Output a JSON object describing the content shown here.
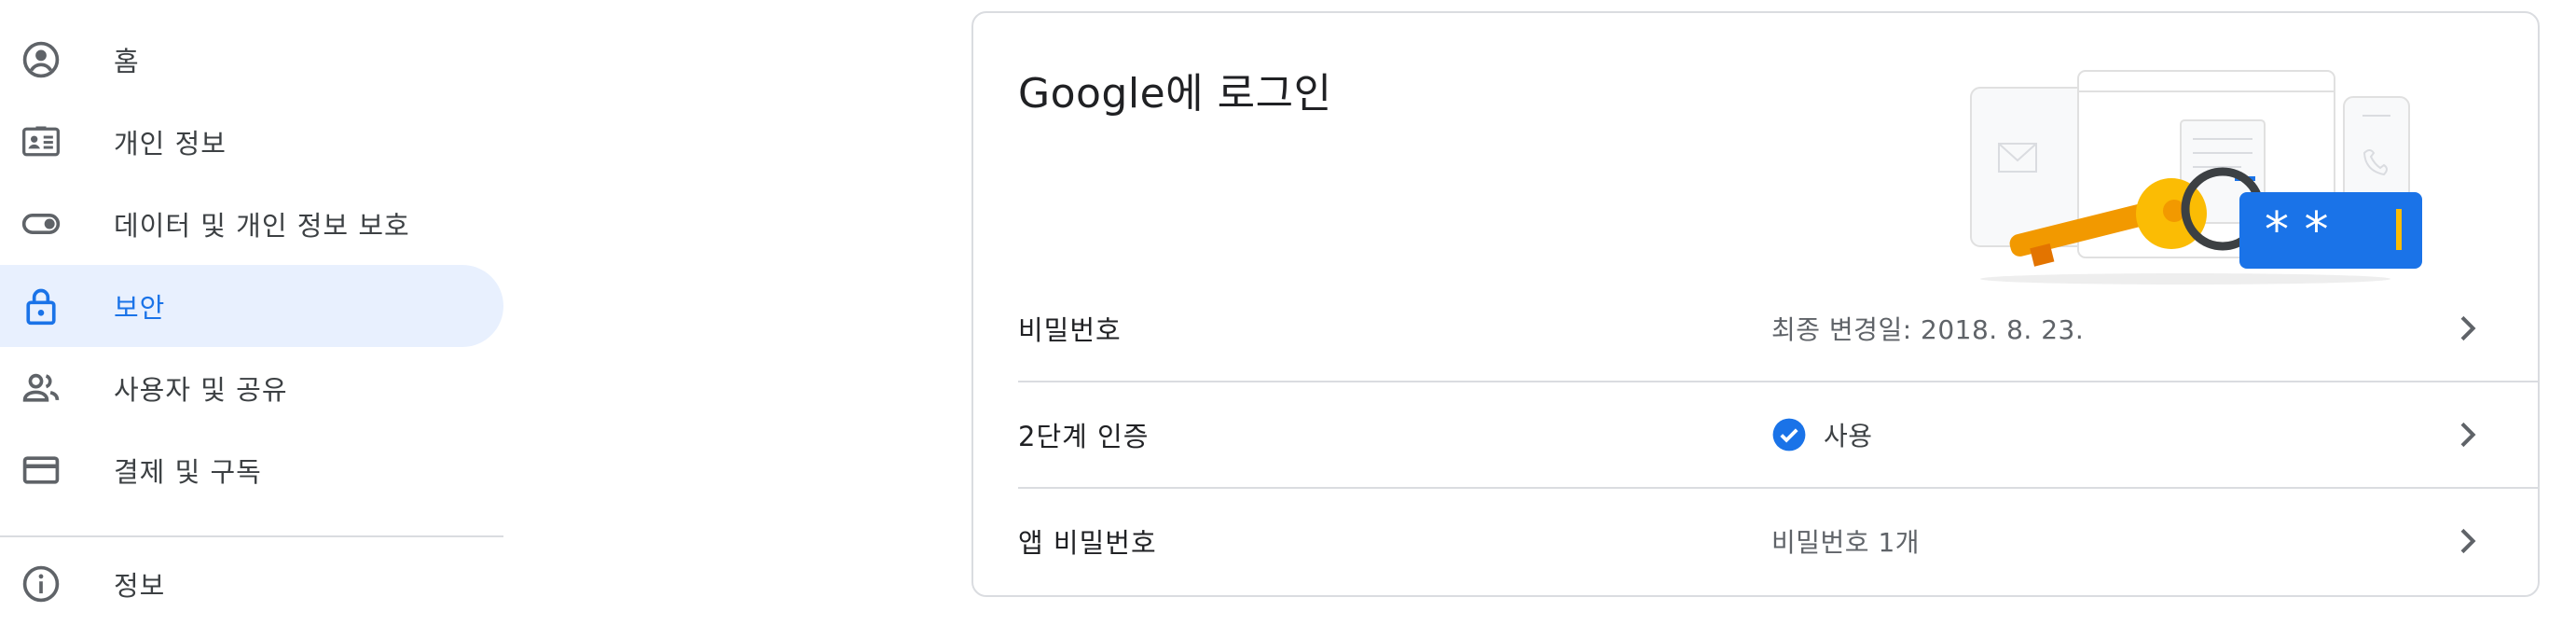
{
  "sidebar": {
    "items": [
      {
        "label": "홈",
        "icon": "account-circle-icon"
      },
      {
        "label": "개인 정보",
        "icon": "id-card-icon"
      },
      {
        "label": "데이터 및 개인 정보 보호",
        "icon": "toggle-icon"
      },
      {
        "label": "보안",
        "icon": "lock-icon",
        "active": true
      },
      {
        "label": "사용자 및 공유",
        "icon": "people-icon"
      },
      {
        "label": "결제 및 구독",
        "icon": "credit-card-icon"
      },
      {
        "label": "정보",
        "icon": "info-icon"
      }
    ]
  },
  "card": {
    "title": "Google에 로그인",
    "rows": [
      {
        "label": "비밀번호",
        "value": "최종 변경일: 2018. 8. 23."
      },
      {
        "label": "2단계 인증",
        "value": "사용",
        "status_icon": "check-circle-icon"
      },
      {
        "label": "앱 비밀번호",
        "value": "비밀번호 1개"
      }
    ]
  },
  "colors": {
    "accent": "#1a73e8",
    "active_bg": "#e8f0fe",
    "divider": "#dadce0",
    "text_primary": "#202124",
    "text_secondary": "#5f6368"
  }
}
